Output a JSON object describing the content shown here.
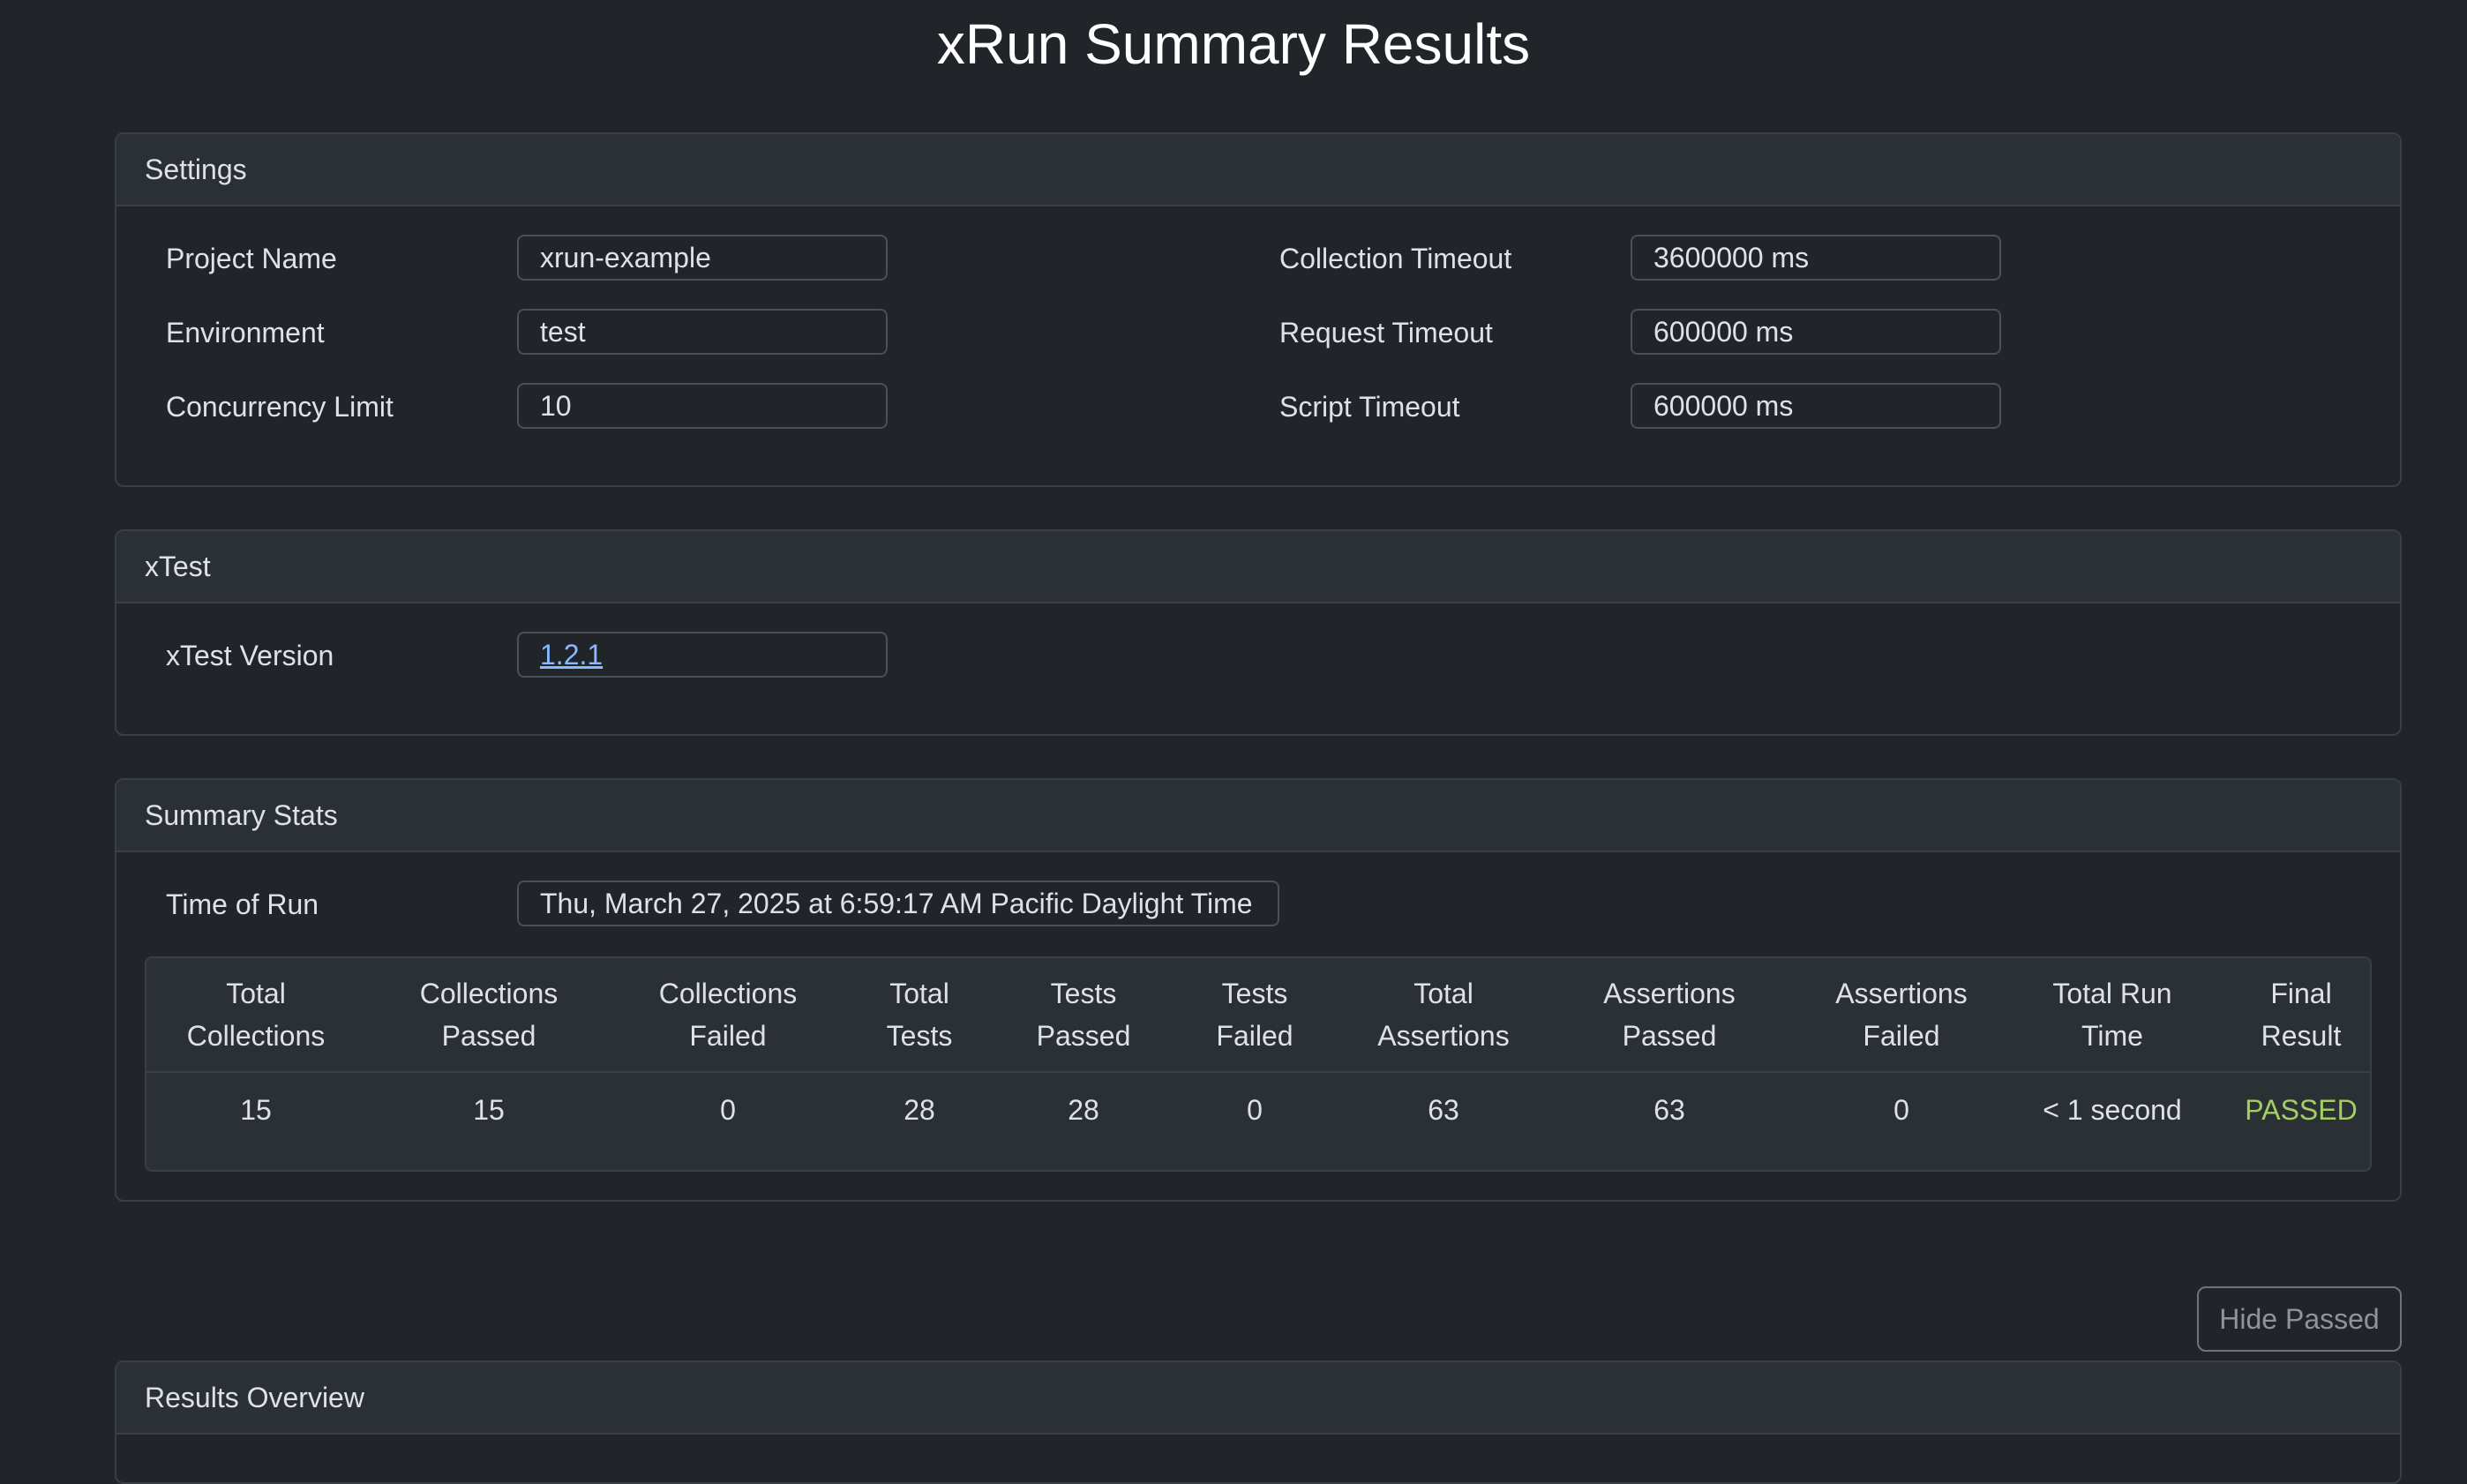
{
  "page": {
    "title": "xRun Summary Results"
  },
  "settings": {
    "header": "Settings",
    "project_name_label": "Project Name",
    "project_name_value": "xrun-example",
    "environment_label": "Environment",
    "environment_value": "test",
    "concurrency_label": "Concurrency Limit",
    "concurrency_value": "10",
    "collection_timeout_label": "Collection Timeout",
    "collection_timeout_value": "3600000 ms",
    "request_timeout_label": "Request Timeout",
    "request_timeout_value": "600000 ms",
    "script_timeout_label": "Script Timeout",
    "script_timeout_value": "600000 ms"
  },
  "xtest": {
    "header": "xTest",
    "version_label": "xTest Version",
    "version_value": "1.2.1"
  },
  "summary": {
    "header": "Summary Stats",
    "time_label": "Time of Run",
    "time_value": "Thu, March 27, 2025 at 6:59:17 AM Pacific Daylight Time",
    "columns": [
      [
        "Total",
        "Collections"
      ],
      [
        "Collections",
        "Passed"
      ],
      [
        "Collections",
        "Failed"
      ],
      [
        "Total",
        "Tests"
      ],
      [
        "Tests",
        "Passed"
      ],
      [
        "Tests",
        "Failed"
      ],
      [
        "Total",
        "Assertions"
      ],
      [
        "Assertions",
        "Passed"
      ],
      [
        "Assertions",
        "Failed"
      ],
      [
        "Total Run",
        "Time"
      ],
      [
        "Final",
        "Result"
      ]
    ],
    "values": [
      "15",
      "15",
      "0",
      "28",
      "28",
      "0",
      "63",
      "63",
      "0",
      "< 1 second",
      "PASSED"
    ],
    "result_color": "#a3cf62"
  },
  "controls": {
    "hide_passed_label": "Hide Passed"
  },
  "results": {
    "header": "Results Overview"
  },
  "theme": {
    "background": "#212529",
    "card_header": "#2b3035",
    "link": "#8bb9fe"
  }
}
